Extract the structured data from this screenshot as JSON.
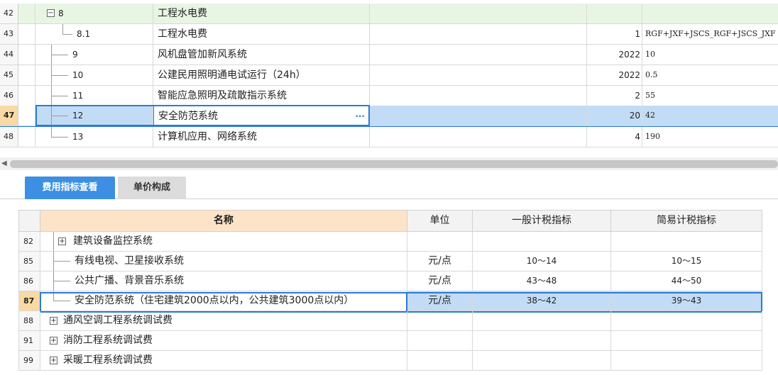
{
  "top_grid": {
    "rows": [
      {
        "num": "42",
        "code": "8",
        "name": "工程水电费",
        "qty": "",
        "formula": ""
      },
      {
        "num": "43",
        "code": "8.1",
        "name": "工程水电费",
        "qty": "1",
        "formula": "RGF+JXF+JSCS_RGF+JSCS_JXF"
      },
      {
        "num": "44",
        "code": "9",
        "name": "风机盘管加新风系统",
        "qty": "2022",
        "formula": "10"
      },
      {
        "num": "45",
        "code": "10",
        "name": "公建民用照明通电试运行（24h）",
        "qty": "2022",
        "formula": "0.5"
      },
      {
        "num": "46",
        "code": "11",
        "name": "智能应急照明及疏散指示系统",
        "qty": "2",
        "formula": "55"
      },
      {
        "num": "47",
        "code": "12",
        "name": "安全防范系统",
        "qty": "20",
        "formula": "42"
      },
      {
        "num": "48",
        "code": "13",
        "name": "计算机应用、网络系统",
        "qty": "4",
        "formula": "190"
      }
    ],
    "ellipsis": "···"
  },
  "tabs": {
    "active": "费用指标查看",
    "inactive": "单价构成"
  },
  "bottom_grid": {
    "headers": {
      "name": "名称",
      "unit": "单位",
      "general": "一般计税指标",
      "simple": "简易计税指标"
    },
    "rows": [
      {
        "num": "82",
        "name": "建筑设备监控系统",
        "unit": "",
        "general": "",
        "simple": "",
        "expandable": true
      },
      {
        "num": "85",
        "name": "有线电视、卫星接收系统",
        "unit": "元/点",
        "general": "10～14",
        "simple": "10～15"
      },
      {
        "num": "86",
        "name": "公共广播、背景音乐系统",
        "unit": "元/点",
        "general": "43～48",
        "simple": "44～50"
      },
      {
        "num": "87",
        "name": "安全防范系统（住宅建筑2000点以内，公共建筑3000点以内）",
        "unit": "元/点",
        "general": "38～42",
        "simple": "39～43"
      },
      {
        "num": "88",
        "name": "通风空调工程系统调试费",
        "unit": "",
        "general": "",
        "simple": "",
        "expandable": true
      },
      {
        "num": "91",
        "name": "消防工程系统调试费",
        "unit": "",
        "general": "",
        "simple": "",
        "expandable": true
      },
      {
        "num": "99",
        "name": "采暖工程系统调试费",
        "unit": "",
        "general": "",
        "simple": "",
        "expandable": true
      }
    ]
  },
  "colors": {
    "accent": "#3c8fe3",
    "selection": "#c3dcf5",
    "selected_row_num": "#f9d9a4",
    "header_highlight": "#fde4c8",
    "row_green": "#e8f5e3"
  }
}
